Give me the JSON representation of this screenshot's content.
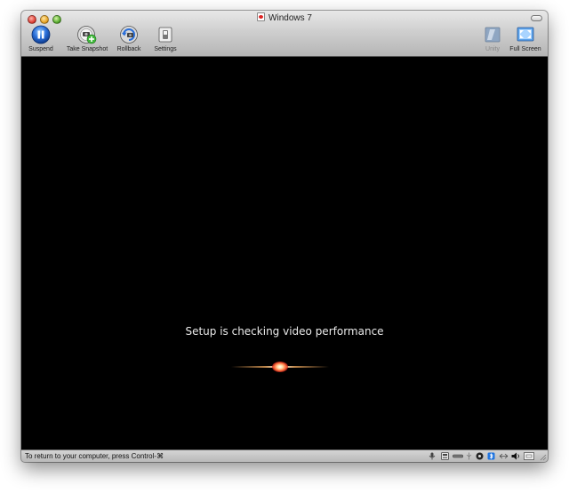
{
  "window": {
    "title": "Windows 7"
  },
  "toolbar": {
    "suspend_label": "Suspend",
    "snapshot_label": "Take Snapshot",
    "rollback_label": "Rollback",
    "settings_label": "Settings",
    "unity_label": "Unity",
    "fullscreen_label": "Full Screen"
  },
  "vm_screen": {
    "message": "Setup is checking video performance"
  },
  "statusbar": {
    "hint": "To return to your computer, press Control-⌘",
    "device_icons": [
      "microphone-icon",
      "hard-disk-icon",
      "network-icon",
      "usb-icon",
      "sound-card-icon",
      "bluetooth-icon",
      "keyboard-icon",
      "volume-icon",
      "cpu-icon"
    ]
  },
  "colors": {
    "screen_background": "#000000",
    "suspend_blue": "#2a6ed8",
    "snapshot_green": "#3fb83a"
  }
}
